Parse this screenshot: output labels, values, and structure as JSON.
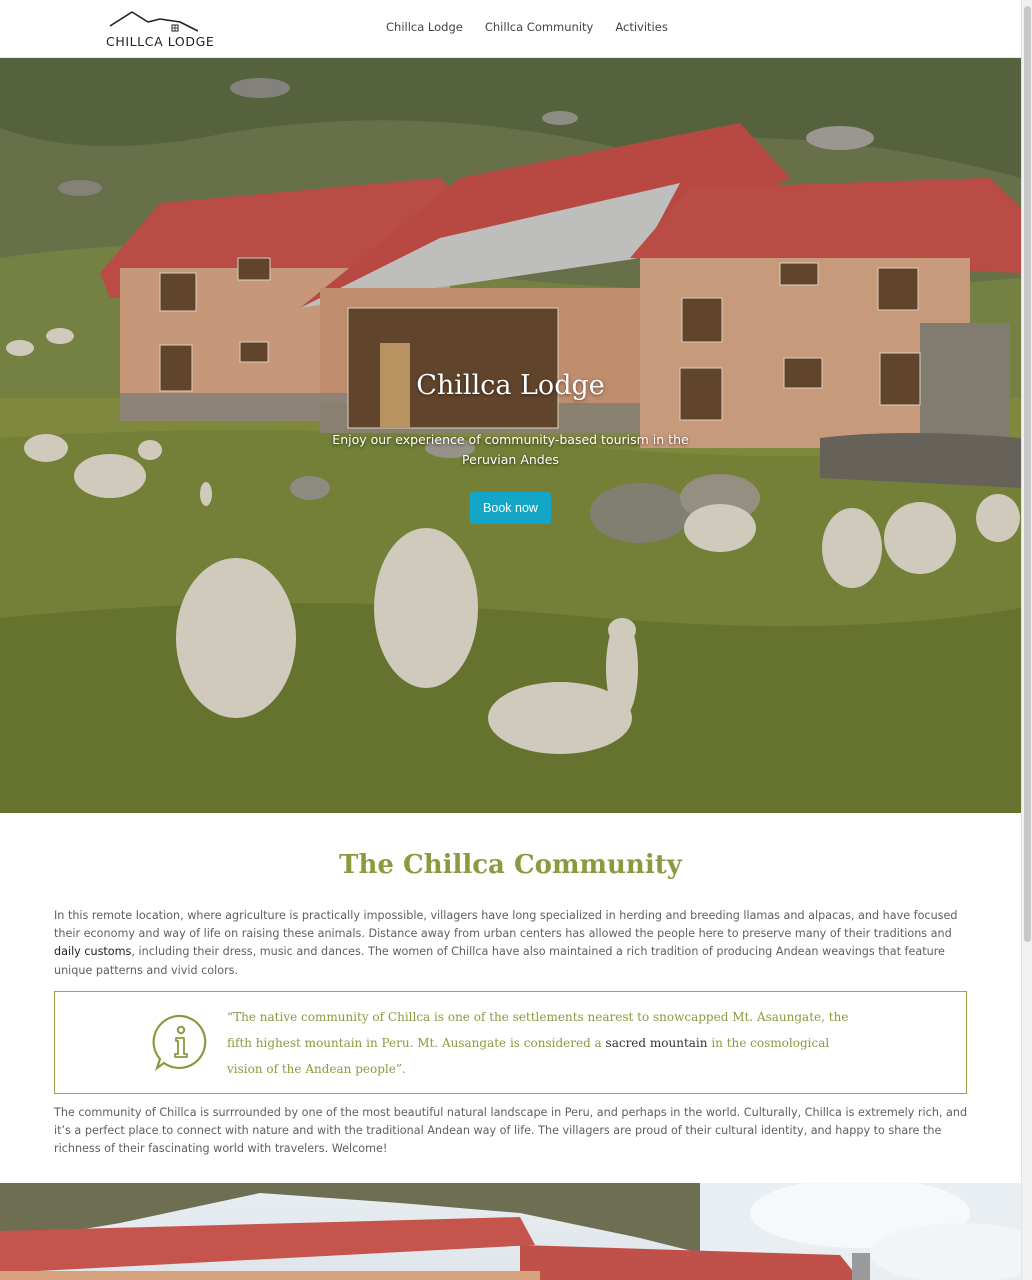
{
  "header": {
    "logo_text": "CHILLCA LODGE",
    "nav": [
      "Chillca Lodge",
      "Chillca Community",
      "Activities"
    ]
  },
  "hero": {
    "title": "Chillca Lodge",
    "subtitle": "Enjoy our experience of community-based tourism in the Peruvian Andes",
    "cta_label": "Book now",
    "cta_color": "#14a6c6"
  },
  "community": {
    "title": "The Chillca Community",
    "para1_a": "In this remote location, where agriculture is practically impossible, villagers have long specialized in herding and breeding llamas and alpacas, and have focused their economy and way of life on raising these animals. Distance away from urban centers has allowed the people here to preserve many of their traditions and ",
    "para1_link": "daily customs",
    "para1_b": ", including their dress, music and dances. The women of Chillca have also maintained a rich tradition of producing Andean weavings that feature unique patterns and vivid colors.",
    "quote_a": "“The native community of Chillca is one of the settlements nearest to snowcapped Mt. Asaungate, the fifth highest mountain in Peru. Mt. Ausangate is considered a ",
    "quote_link": "sacred mountain",
    "quote_b": " in the cosmological vision of the Andean people”.",
    "para2": "The community of Chillca is surrrounded by one of the most beautiful natural landscape in Peru, and perhaps in the world. Culturally, Chillca is extremely rich, and it’s a perfect place to connect with nature and with the traditional Andean way of life. The villagers are proud of their cultural identity, and happy to share the richness of their fascinating world with travelers. Welcome!",
    "accent_color": "#8b9a3e"
  },
  "icons": {
    "logo": "house-roof-logo-icon",
    "quote": "info-icon"
  }
}
